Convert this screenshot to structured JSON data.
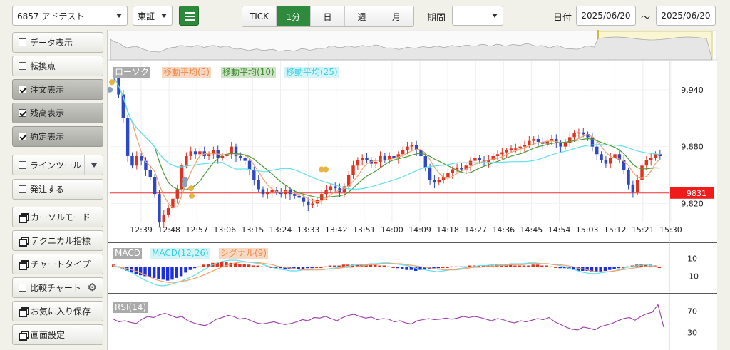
{
  "topbar": {
    "symbol": "6857 アドテスト",
    "market": "東証",
    "timeframes": [
      "TICK",
      "1分",
      "日",
      "週",
      "月"
    ],
    "active_timeframe": "1分",
    "period_label": "期間",
    "period_value": "",
    "date_label": "日付",
    "date_from": "2025/06/20",
    "date_sep": "〜",
    "date_to": "2025/06/20"
  },
  "sidebar": {
    "items": [
      {
        "label": "データ表示",
        "type": "checkbox",
        "checked": false
      },
      {
        "label": "転換点",
        "type": "checkbox",
        "checked": false
      },
      {
        "label": "注文表示",
        "type": "checkbox",
        "checked": true
      },
      {
        "label": "残高表示",
        "type": "checkbox",
        "checked": true
      },
      {
        "label": "約定表示",
        "type": "checkbox",
        "checked": true
      },
      {
        "label": "ラインツール",
        "type": "checkbox",
        "checked": false
      },
      {
        "label": "発注する",
        "type": "checkbox",
        "checked": false
      },
      {
        "label": "カーソルモード",
        "type": "window"
      },
      {
        "label": "テクニカル指標",
        "type": "window"
      },
      {
        "label": "チャートタイプ",
        "type": "window"
      },
      {
        "label": "比較チャート",
        "type": "checkbox",
        "checked": false
      },
      {
        "label": "お気に入り保存",
        "type": "window"
      },
      {
        "label": "画面設定",
        "type": "window"
      }
    ]
  },
  "legend": {
    "candle": "ローソク",
    "ma5": "移動平均(5)",
    "ma10": "移動平均(10)",
    "ma25": "移動平均(25)",
    "macd": "MACD",
    "macd_line": "MACD(12,26)",
    "signal": "シグナル(9)",
    "rsi": "RSI(14)"
  },
  "colors": {
    "candle_up": "#e0321f",
    "candle_down": "#2f47c4",
    "ma5": "#f4a06a",
    "ma10": "#4a9a3a",
    "ma25": "#5ee0ee",
    "rsi": "#9b3aa8",
    "current_line": "#f03030",
    "active_green": "#2e8a3c"
  },
  "chart_data": [
    {
      "type": "candlestick",
      "title": "",
      "x_ticks": [
        "12:39",
        "12:48",
        "12:57",
        "13:06",
        "13:15",
        "13:24",
        "13:33",
        "13:42",
        "13:51",
        "14:00",
        "14:09",
        "14:18",
        "14:27",
        "14:36",
        "14:45",
        "14:54",
        "15:03",
        "15:12",
        "15:21",
        "15:30"
      ],
      "y_ticks": [
        9940,
        9880,
        9820
      ],
      "ylim": [
        9800,
        9970
      ],
      "current_price": 9831,
      "current_price_label": "9831",
      "close_series": [
        9953,
        9935,
        9910,
        9870,
        9860,
        9870,
        9865,
        9855,
        9848,
        9830,
        9800,
        9808,
        9815,
        9825,
        9835,
        9860,
        9870,
        9875,
        9872,
        9875,
        9870,
        9872,
        9876,
        9868,
        9870,
        9872,
        9880,
        9870,
        9868,
        9865,
        9855,
        9845,
        9835,
        9830,
        9832,
        9834,
        9832,
        9830,
        9834,
        9830,
        9828,
        9826,
        9822,
        9818,
        9820,
        9824,
        9830,
        9834,
        9838,
        9836,
        9832,
        9838,
        9850,
        9860,
        9866,
        9868,
        9866,
        9862,
        9864,
        9870,
        9866,
        9870,
        9868,
        9872,
        9876,
        9880,
        9882,
        9876,
        9870,
        9858,
        9845,
        9842,
        9845,
        9848,
        9852,
        9856,
        9858,
        9856,
        9860,
        9865,
        9868,
        9866,
        9864,
        9866,
        9870,
        9872,
        9874,
        9876,
        9878,
        9878,
        9880,
        9882,
        9886,
        9888,
        9885,
        9883,
        9886,
        9888,
        9884,
        9880,
        9884,
        9890,
        9894,
        9895,
        9893,
        9890,
        9880,
        9872,
        9866,
        9862,
        9868,
        9872,
        9866,
        9855,
        9840,
        9832,
        9845,
        9860,
        9866,
        9868,
        9872,
        9870
      ]
    },
    {
      "type": "bar",
      "title": "",
      "y_ticks": [
        10,
        -10
      ],
      "ylim": [
        -25,
        25
      ],
      "histogram": [
        3,
        1,
        -2,
        -4,
        -6,
        -8,
        -9,
        -10,
        -11,
        -12,
        -13,
        -14,
        -15,
        -14,
        -12,
        -10,
        -6,
        -3,
        -1,
        1,
        3,
        4,
        5,
        5,
        6,
        6,
        5,
        5,
        4,
        4,
        3,
        2,
        2,
        1,
        1,
        0,
        -1,
        -1,
        -2,
        -2,
        -1,
        -2,
        -2,
        -1,
        -1,
        0,
        0,
        1,
        2,
        2,
        2,
        3,
        3,
        3,
        4,
        4,
        4,
        3,
        3,
        2,
        2,
        1,
        0,
        -1,
        -2,
        -3,
        -3,
        -4,
        -3,
        -3,
        -2,
        -1,
        -1,
        0,
        0,
        1,
        1,
        1,
        1,
        2,
        2,
        2,
        2,
        2,
        2,
        3,
        3,
        3,
        3,
        2,
        2,
        2,
        2,
        3,
        3,
        2,
        2,
        1,
        0,
        -1,
        -1,
        -2,
        -3,
        -4,
        -4,
        -4,
        -5,
        -5,
        -5,
        -4,
        -3,
        -2,
        -1,
        0,
        1,
        2,
        3,
        4,
        4,
        3,
        2,
        0
      ],
      "macd": [
        2,
        0,
        -3,
        -6,
        -10,
        -14,
        -17,
        -20,
        -21,
        -20,
        -18,
        -16,
        -13,
        -10,
        -6,
        -2,
        2,
        5,
        7,
        8,
        8,
        7,
        6,
        5,
        4,
        2,
        0,
        -2,
        -3,
        -4,
        -4,
        -3,
        -3,
        -2,
        -2,
        -2,
        -1,
        0,
        1,
        2,
        3,
        3,
        4,
        4,
        5,
        5,
        4,
        3,
        2,
        0,
        -2,
        -3,
        -4,
        -5,
        -4,
        -3,
        -2,
        -1,
        0,
        1,
        2,
        2,
        3,
        3,
        3,
        4,
        4,
        4,
        5,
        5,
        4,
        4,
        3,
        2,
        0,
        -2,
        -4,
        -6,
        -7,
        -7,
        -6,
        -5,
        -4,
        -2,
        0,
        1,
        2,
        3,
        2,
        0
      ],
      "signal": [
        1,
        0,
        -1,
        -3,
        -5,
        -8,
        -11,
        -14,
        -16,
        -17,
        -17,
        -16,
        -15,
        -13,
        -11,
        -8,
        -5,
        -2,
        1,
        3,
        5,
        6,
        6,
        6,
        5,
        4,
        3,
        1,
        0,
        -1,
        -2,
        -3,
        -3,
        -3,
        -3,
        -2,
        -2,
        -1,
        0,
        0,
        1,
        2,
        3,
        3,
        4,
        4,
        4,
        4,
        3,
        2,
        1,
        0,
        -1,
        -2,
        -3,
        -3,
        -3,
        -2,
        -1,
        0,
        0,
        1,
        1,
        2,
        2,
        3,
        3,
        3,
        4,
        4,
        4,
        4,
        3,
        3,
        2,
        1,
        -1,
        -2,
        -4,
        -5,
        -5,
        -5,
        -4,
        -3,
        -2,
        -1,
        0,
        1,
        1,
        1
      ]
    },
    {
      "type": "line",
      "title": "",
      "y_ticks": [
        70,
        30
      ],
      "ylim": [
        0,
        100
      ],
      "rsi": [
        55,
        50,
        52,
        49,
        47,
        55,
        60,
        58,
        63,
        66,
        62,
        58,
        60,
        52,
        48,
        45,
        43,
        48,
        55,
        58,
        62,
        60,
        55,
        57,
        52,
        48,
        46,
        48,
        50,
        47,
        45,
        47,
        50,
        54,
        52,
        58,
        57,
        60,
        56,
        52,
        58,
        62,
        64,
        60,
        57,
        59,
        54,
        56,
        55,
        50,
        52,
        48,
        46,
        52,
        54,
        56,
        54,
        55,
        57,
        55,
        57,
        60,
        58,
        60,
        58,
        55,
        52,
        56,
        54,
        50,
        48,
        52,
        50,
        53,
        56,
        54,
        58,
        50,
        45,
        40,
        36,
        35,
        40,
        38,
        35,
        41,
        44,
        47,
        52,
        56,
        58,
        53,
        60,
        65,
        68,
        82,
        40
      ]
    }
  ]
}
